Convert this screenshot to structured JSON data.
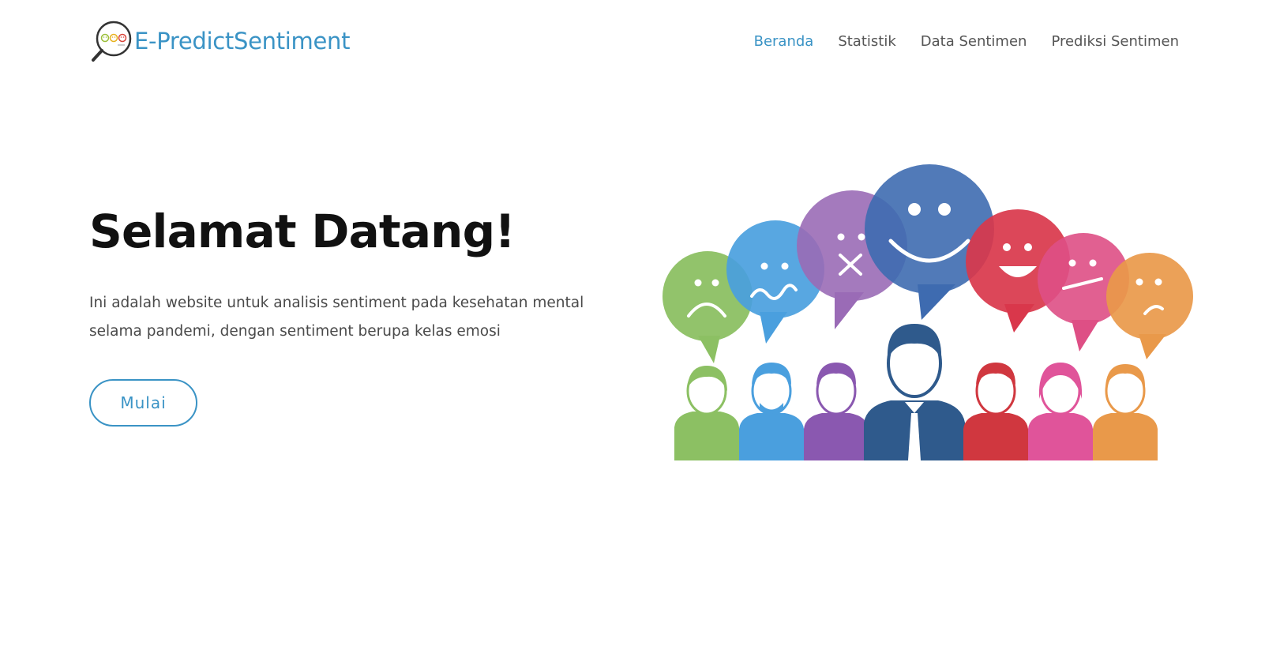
{
  "header": {
    "brand": "E-PredictSentiment",
    "logo_icon": "magnifier-emoji-icon",
    "nav": [
      {
        "label": "Beranda",
        "active": true
      },
      {
        "label": "Statistik",
        "active": false
      },
      {
        "label": "Data Sentimen",
        "active": false
      },
      {
        "label": "Prediksi Sentimen",
        "active": false
      }
    ]
  },
  "hero": {
    "title": "Selamat Datang!",
    "description": "Ini adalah website untuk analisis sentiment pada kesehatan mental selama pandemi, dengan sentiment berupa kelas emosi",
    "button_label": "Mulai",
    "illustration": "people-with-emotion-speech-bubbles"
  },
  "colors": {
    "accent": "#3a93c5",
    "text_dark": "#111111",
    "text_muted": "#4a4a4a",
    "nav_text": "#555555"
  }
}
